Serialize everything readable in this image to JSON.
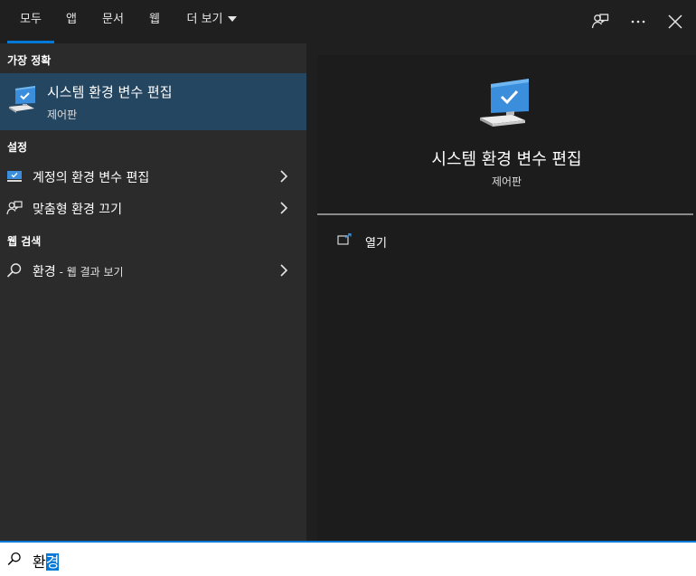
{
  "tabs": {
    "all": "모두",
    "apps": "앱",
    "documents": "문서",
    "web": "웹",
    "more": "더 보기"
  },
  "toolbar_icons": [
    "feedback-icon",
    "more-options-icon",
    "close-icon"
  ],
  "left": {
    "best_match": {
      "section": "가장 정확",
      "title": "시스템 환경 변수 편집",
      "subtitle": "제어판",
      "icon": "system-monitor-icon"
    },
    "settings": {
      "section": "설정",
      "items": [
        {
          "label": "계정의 환경 변수 편집",
          "icon": "monitor-icon"
        },
        {
          "label": "맞춤형 환경 끄기",
          "icon": "person-chat-icon"
        }
      ]
    },
    "web_search": {
      "section": "웹 검색",
      "query": "환경",
      "suffix": " - 웹 결과 보기",
      "icon": "search-icon"
    }
  },
  "right": {
    "title": "시스템 환경 변수 편집",
    "subtitle": "제어판",
    "actions": [
      {
        "label": "열기",
        "icon": "open-icon"
      }
    ]
  },
  "search": {
    "text_prefix": "환",
    "text_selected": "경"
  },
  "colors": {
    "accent": "#0078d7",
    "selected_row": "#254661",
    "left_bg": "#2b2b2b",
    "right_bg": "#1c1c1c"
  }
}
